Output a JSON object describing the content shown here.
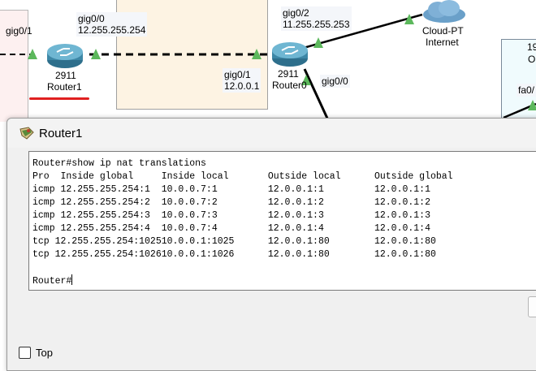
{
  "topology": {
    "left_port": "gig0/1",
    "router1_port_right": {
      "name": "gig0/0",
      "ip": "12.255.255.254"
    },
    "router1": {
      "model": "2911",
      "name": "Router1"
    },
    "router0_port_left": {
      "name": "gig0/1",
      "ip": "12.0.0.1"
    },
    "router0": {
      "model": "2911",
      "name": "Router0"
    },
    "router0_port_top": {
      "name": "gig0/2",
      "ip": "11.255.255.253"
    },
    "router0_port_bottom": "gig0/0",
    "cloud": {
      "type": "Cloud-PT",
      "name": "Internet"
    },
    "right_partial_1": "19",
    "right_partial_2": "O",
    "right_partial_port": "fa0/"
  },
  "window": {
    "title": "Router1",
    "top_checkbox_label": "Top"
  },
  "terminal": {
    "lines": [
      "Router#show ip nat translations",
      "Pro  Inside global     Inside local       Outside local      Outside global",
      "icmp 12.255.255.254:1  10.0.0.7:1         12.0.0.1:1         12.0.0.1:1",
      "icmp 12.255.255.254:2  10.0.0.7:2         12.0.0.1:2         12.0.0.1:2",
      "icmp 12.255.255.254:3  10.0.0.7:3         12.0.0.1:3         12.0.0.1:3",
      "icmp 12.255.255.254:4  10.0.0.7:4         12.0.0.1:4         12.0.0.1:4",
      "tcp 12.255.255.254:102510.0.0.1:1025      12.0.0.1:80        12.0.0.1:80",
      "tcp 12.255.255.254:102610.0.0.1:1026      12.0.0.1:80        12.0.0.1:80"
    ],
    "prompt": "Router#"
  },
  "colors": {
    "area_tan": "#fdf3e3",
    "area_pink": "#fdf0f0",
    "link_green": "#5cb85c",
    "underline_red": "#e02020",
    "router_blue": "#3d87a6"
  }
}
